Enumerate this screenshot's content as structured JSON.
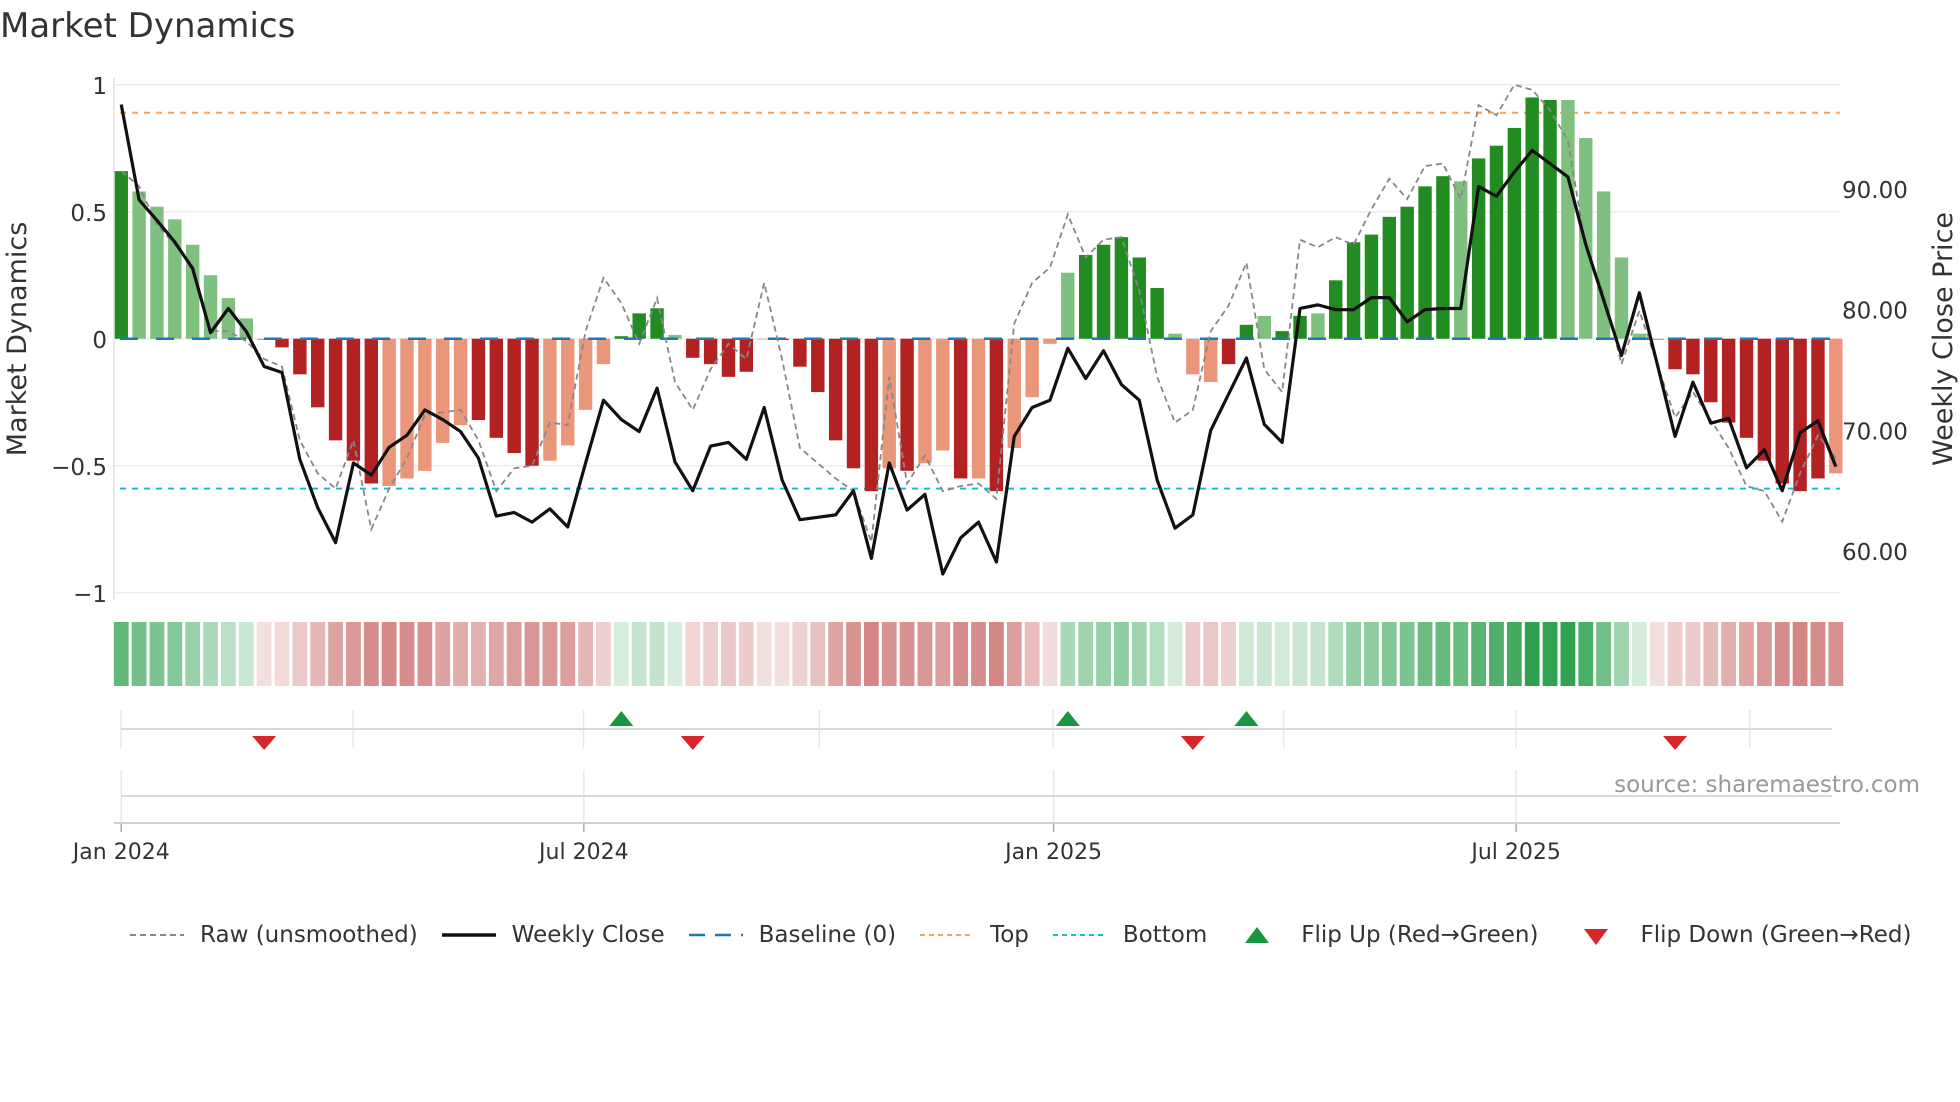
{
  "title": "Market Dynamics",
  "source": "source: sharemaestro.com",
  "chart_data": {
    "type": "bar",
    "title": "Market Dynamics",
    "ylabel": "Market Dynamics",
    "y2label": "Weekly Close Price",
    "ylim": [
      -1,
      1
    ],
    "y2lim": [
      54.5,
      98.5
    ],
    "yticks": [
      {
        "v": 1,
        "label": "1"
      },
      {
        "v": 0.5,
        "label": "0.5"
      },
      {
        "v": 0,
        "label": "0"
      },
      {
        "v": -0.5,
        "label": "−0.5"
      },
      {
        "v": -1,
        "label": "−1"
      }
    ],
    "y2ticks": [
      {
        "v": 90,
        "label": "90.00"
      },
      {
        "v": 80,
        "label": "80.00"
      },
      {
        "v": 70,
        "label": "70.00"
      },
      {
        "v": 60,
        "label": "60.00"
      }
    ],
    "xticks": [
      {
        "week": 0,
        "label": "Jan 2024"
      },
      {
        "week": 25.9,
        "label": "Jul 2024"
      },
      {
        "week": 52.2,
        "label": "Jan 2025"
      },
      {
        "week": 78.1,
        "label": "Jul 2025"
      }
    ],
    "quarter_grid_weeks": [
      0,
      13,
      25.9,
      39.1,
      52.2,
      65.1,
      78.1,
      91.2
    ],
    "top_level": 0.89,
    "bottom_level": -0.59,
    "baseline": 0,
    "bars": [
      0.66,
      0.58,
      0.52,
      0.47,
      0.37,
      0.25,
      0.16,
      0.08,
      -0.005,
      -0.034,
      -0.14,
      -0.27,
      -0.4,
      -0.48,
      -0.57,
      -0.58,
      -0.55,
      -0.52,
      -0.41,
      -0.34,
      -0.32,
      -0.39,
      -0.45,
      -0.5,
      -0.48,
      -0.42,
      -0.28,
      -0.1,
      0.01,
      0.1,
      0.12,
      0.015,
      -0.075,
      -0.1,
      -0.15,
      -0.13,
      -0.003,
      -0.005,
      -0.11,
      -0.21,
      -0.4,
      -0.51,
      -0.6,
      -0.51,
      -0.52,
      -0.49,
      -0.44,
      -0.55,
      -0.55,
      -0.6,
      -0.43,
      -0.23,
      -0.02,
      0.26,
      0.33,
      0.37,
      0.4,
      0.32,
      0.2,
      0.02,
      -0.14,
      -0.17,
      -0.1,
      0.055,
      0.09,
      0.03,
      0.09,
      0.1,
      0.23,
      0.38,
      0.41,
      0.48,
      0.52,
      0.6,
      0.64,
      0.62,
      0.71,
      0.76,
      0.83,
      0.95,
      0.94,
      0.94,
      0.79,
      0.58,
      0.32,
      0.02,
      -0.005,
      -0.12,
      -0.14,
      -0.25,
      -0.33,
      -0.39,
      -0.48,
      -0.57,
      -0.6,
      -0.55,
      -0.53
    ],
    "bar_shade": "dllllllllddddddlllllddddlllldddlddddlddddddldlldldlllldddddlllddlddldddddddldddddlllllldddddddddll",
    "raw": [
      0.66,
      0.6,
      0.45,
      0.37,
      0.29,
      0.03,
      0.03,
      -0.01,
      -0.08,
      -0.11,
      -0.4,
      -0.53,
      -0.59,
      -0.4,
      -0.75,
      -0.59,
      -0.47,
      -0.3,
      -0.29,
      -0.28,
      -0.4,
      -0.6,
      -0.51,
      -0.5,
      -0.33,
      -0.34,
      0.03,
      0.24,
      0.14,
      -0.02,
      0.16,
      -0.17,
      -0.28,
      -0.12,
      -0.02,
      -0.08,
      0.22,
      -0.08,
      -0.43,
      -0.49,
      -0.55,
      -0.6,
      -0.8,
      -0.15,
      -0.57,
      -0.46,
      -0.6,
      -0.58,
      -0.57,
      -0.63,
      0.06,
      0.22,
      0.28,
      0.49,
      0.32,
      0.39,
      0.4,
      0.19,
      -0.15,
      -0.33,
      -0.28,
      0.03,
      0.13,
      0.3,
      -0.12,
      -0.21,
      0.39,
      0.36,
      0.4,
      0.37,
      0.51,
      0.63,
      0.55,
      0.68,
      0.69,
      0.55,
      0.92,
      0.88,
      1.0,
      0.98,
      0.9,
      0.78,
      0.36,
      0.18,
      -0.1,
      0.11,
      -0.1,
      -0.31,
      -0.21,
      -0.32,
      -0.43,
      -0.58,
      -0.6,
      -0.72,
      -0.53,
      -0.38,
      -0.47
    ],
    "close": [
      97.0,
      89.1,
      87.4,
      85.6,
      83.4,
      78.1,
      80.1,
      78.2,
      75.3,
      74.8,
      67.6,
      63.6,
      60.7,
      67.3,
      66.3,
      68.6,
      69.6,
      71.7,
      70.9,
      69.9,
      67.7,
      62.9,
      63.2,
      62.4,
      63.5,
      62.0,
      67.3,
      72.5,
      70.9,
      69.9,
      73.5,
      67.4,
      65.0,
      68.7,
      69.0,
      67.6,
      71.9,
      65.9,
      62.6,
      62.8,
      63.0,
      65.0,
      59.4,
      67.3,
      63.4,
      64.7,
      58.1,
      61.1,
      62.4,
      59.1,
      69.5,
      71.9,
      72.5,
      76.8,
      74.3,
      76.6,
      73.8,
      72.5,
      65.9,
      61.9,
      63.0,
      70.0,
      73.0,
      76.0,
      70.5,
      69.0,
      80.1,
      80.4,
      80.0,
      80.0,
      81.0,
      81.0,
      79.0,
      80.0,
      80.1,
      80.1,
      90.2,
      89.4,
      91.4,
      93.2,
      92.1,
      91.0,
      85.4,
      80.8,
      76.2,
      81.4,
      75.5,
      69.5,
      74.0,
      70.6,
      71.0,
      66.9,
      68.4,
      65.0,
      69.8,
      70.8,
      67.0
    ],
    "flip_up_weeks": [
      28,
      53,
      63
    ],
    "flip_down_weeks": [
      8,
      32,
      60,
      87
    ],
    "colors": {
      "bar_up_strong": "#228b22",
      "bar_up_weak": "#7fbf7f",
      "bar_down_strong": "#b22222",
      "bar_down_weak": "#e9967a",
      "close": "#111111",
      "raw": "#888888",
      "baseline": "#1f77b4",
      "top": "#f4a460",
      "bottom": "#17becf",
      "flip_up": "#1a9641",
      "flip_down": "#d7262a",
      "heat_up": "#2ca04c",
      "heat_down": "#c0504d"
    },
    "legend": [
      {
        "key": "raw",
        "label": "Raw (unsmoothed)"
      },
      {
        "key": "close",
        "label": "Weekly Close"
      },
      {
        "key": "baseline",
        "label": "Baseline (0)"
      },
      {
        "key": "top",
        "label": "Top"
      },
      {
        "key": "bottom",
        "label": "Bottom"
      },
      {
        "key": "flip_up",
        "label": "Flip Up (Red→Green)"
      },
      {
        "key": "flip_down",
        "label": "Flip Down (Green→Red)"
      }
    ],
    "legend_position": "bottom"
  }
}
